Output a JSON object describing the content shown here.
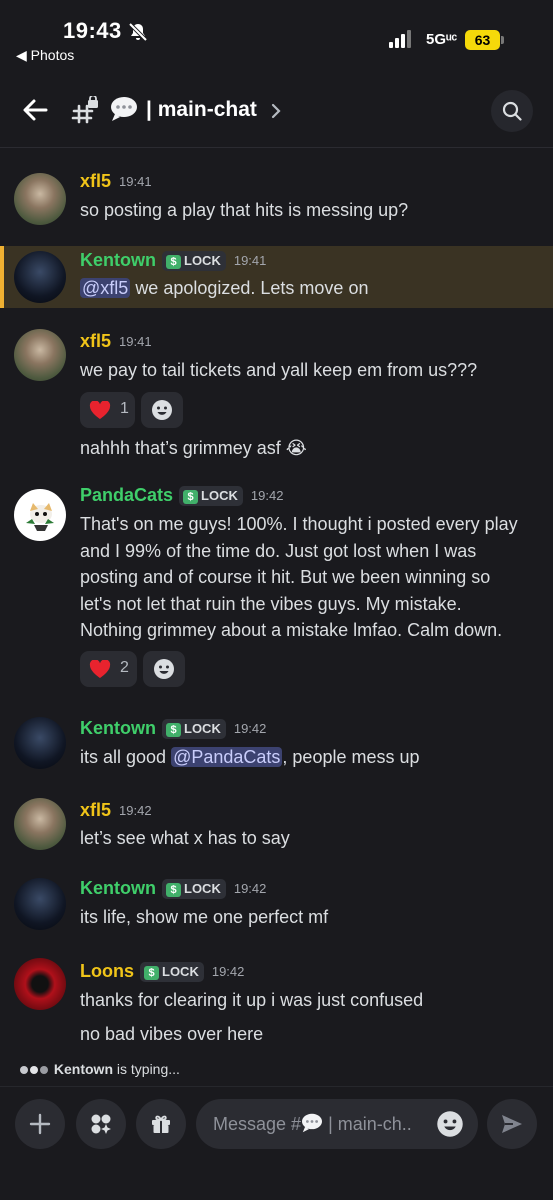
{
  "status_bar": {
    "time": "19:43",
    "back_app": "◀ Photos",
    "network": "5Gᵘᶜ",
    "battery": "63"
  },
  "header": {
    "channel_name": "| main-chat"
  },
  "messages": [
    {
      "user": "xfl5",
      "time": "19:41",
      "lines": [
        "so posting a play that hits is messing up?"
      ]
    },
    {
      "user": "Kentown",
      "tag": "LOCK",
      "time": "19:41",
      "mention": "@xfl5",
      "text": "we apologized. Lets move on"
    },
    {
      "user": "xfl5",
      "time": "19:41",
      "lines": [
        "we pay to tail tickets and yall keep em from us???"
      ],
      "reaction": {
        "emoji": "heart",
        "count": "1"
      },
      "extra": "nahhh that’s grimmey asf 😭"
    },
    {
      "user": "PandaCats",
      "tag": "LOCK",
      "time": "19:42",
      "lines": [
        "That's on me guys! 100%. I thought i posted every play",
        "and I 99% of the time do. Just got lost when I was",
        "posting and of course it hit. But we been winning so",
        "let's not let that ruin the vibes guys. My mistake.",
        "Nothing grimmey about a mistake lmfao. Calm down."
      ],
      "reaction": {
        "emoji": "heart",
        "count": "2"
      }
    },
    {
      "user": "Kentown",
      "tag": "LOCK",
      "time": "19:42",
      "prefix": "its all good",
      "mention": "@PandaCats",
      "suffix": ", people mess up"
    },
    {
      "user": "xfl5",
      "time": "19:42",
      "lines": [
        "let’s see what x has to say"
      ]
    },
    {
      "user": "Kentown",
      "tag": "LOCK",
      "time": "19:42",
      "lines": [
        "its life, show me one perfect mf"
      ]
    },
    {
      "user": "Loons",
      "tag": "LOCK",
      "time": "19:42",
      "lines": [
        "thanks for clearing it up i was just confused"
      ],
      "extra": "no bad vibes over here"
    }
  ],
  "typing": {
    "user": "Kentown",
    "suffix": "is typing..."
  },
  "composer": {
    "placeholder_prefix": "Message #",
    "placeholder_suffix": "| main-ch.."
  },
  "colors": {
    "background": "#1a1a1e",
    "name_yellow": "#f0c419",
    "name_green": "#3fce6a",
    "highlight": "#3a3323",
    "mention": "#3c4270"
  },
  "icons": [
    "bell-slash-icon",
    "signal-icon",
    "back-arrow-icon",
    "hash-lock-icon",
    "speech-bubble-icon",
    "chevron-right-icon",
    "search-icon",
    "heart-icon",
    "add-reaction-icon",
    "plus-icon",
    "apps-icon",
    "gift-icon",
    "emoji-icon",
    "send-icon"
  ]
}
